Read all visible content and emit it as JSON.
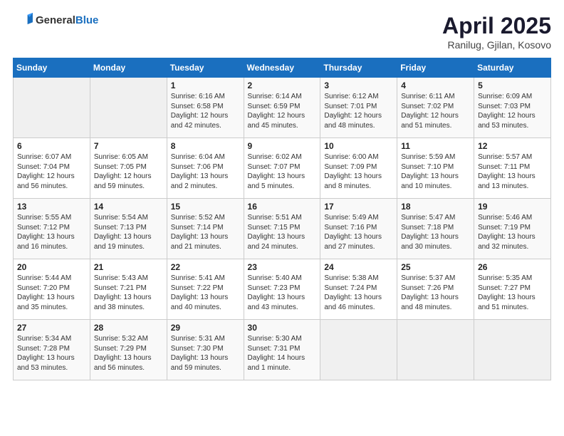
{
  "header": {
    "logo_general": "General",
    "logo_blue": "Blue",
    "title": "April 2025",
    "location": "Ranilug, Gjilan, Kosovo"
  },
  "weekdays": [
    "Sunday",
    "Monday",
    "Tuesday",
    "Wednesday",
    "Thursday",
    "Friday",
    "Saturday"
  ],
  "weeks": [
    [
      {
        "day": "",
        "detail": ""
      },
      {
        "day": "",
        "detail": ""
      },
      {
        "day": "1",
        "detail": "Sunrise: 6:16 AM\nSunset: 6:58 PM\nDaylight: 12 hours and 42 minutes."
      },
      {
        "day": "2",
        "detail": "Sunrise: 6:14 AM\nSunset: 6:59 PM\nDaylight: 12 hours and 45 minutes."
      },
      {
        "day": "3",
        "detail": "Sunrise: 6:12 AM\nSunset: 7:01 PM\nDaylight: 12 hours and 48 minutes."
      },
      {
        "day": "4",
        "detail": "Sunrise: 6:11 AM\nSunset: 7:02 PM\nDaylight: 12 hours and 51 minutes."
      },
      {
        "day": "5",
        "detail": "Sunrise: 6:09 AM\nSunset: 7:03 PM\nDaylight: 12 hours and 53 minutes."
      }
    ],
    [
      {
        "day": "6",
        "detail": "Sunrise: 6:07 AM\nSunset: 7:04 PM\nDaylight: 12 hours and 56 minutes."
      },
      {
        "day": "7",
        "detail": "Sunrise: 6:05 AM\nSunset: 7:05 PM\nDaylight: 12 hours and 59 minutes."
      },
      {
        "day": "8",
        "detail": "Sunrise: 6:04 AM\nSunset: 7:06 PM\nDaylight: 13 hours and 2 minutes."
      },
      {
        "day": "9",
        "detail": "Sunrise: 6:02 AM\nSunset: 7:07 PM\nDaylight: 13 hours and 5 minutes."
      },
      {
        "day": "10",
        "detail": "Sunrise: 6:00 AM\nSunset: 7:09 PM\nDaylight: 13 hours and 8 minutes."
      },
      {
        "day": "11",
        "detail": "Sunrise: 5:59 AM\nSunset: 7:10 PM\nDaylight: 13 hours and 10 minutes."
      },
      {
        "day": "12",
        "detail": "Sunrise: 5:57 AM\nSunset: 7:11 PM\nDaylight: 13 hours and 13 minutes."
      }
    ],
    [
      {
        "day": "13",
        "detail": "Sunrise: 5:55 AM\nSunset: 7:12 PM\nDaylight: 13 hours and 16 minutes."
      },
      {
        "day": "14",
        "detail": "Sunrise: 5:54 AM\nSunset: 7:13 PM\nDaylight: 13 hours and 19 minutes."
      },
      {
        "day": "15",
        "detail": "Sunrise: 5:52 AM\nSunset: 7:14 PM\nDaylight: 13 hours and 21 minutes."
      },
      {
        "day": "16",
        "detail": "Sunrise: 5:51 AM\nSunset: 7:15 PM\nDaylight: 13 hours and 24 minutes."
      },
      {
        "day": "17",
        "detail": "Sunrise: 5:49 AM\nSunset: 7:16 PM\nDaylight: 13 hours and 27 minutes."
      },
      {
        "day": "18",
        "detail": "Sunrise: 5:47 AM\nSunset: 7:18 PM\nDaylight: 13 hours and 30 minutes."
      },
      {
        "day": "19",
        "detail": "Sunrise: 5:46 AM\nSunset: 7:19 PM\nDaylight: 13 hours and 32 minutes."
      }
    ],
    [
      {
        "day": "20",
        "detail": "Sunrise: 5:44 AM\nSunset: 7:20 PM\nDaylight: 13 hours and 35 minutes."
      },
      {
        "day": "21",
        "detail": "Sunrise: 5:43 AM\nSunset: 7:21 PM\nDaylight: 13 hours and 38 minutes."
      },
      {
        "day": "22",
        "detail": "Sunrise: 5:41 AM\nSunset: 7:22 PM\nDaylight: 13 hours and 40 minutes."
      },
      {
        "day": "23",
        "detail": "Sunrise: 5:40 AM\nSunset: 7:23 PM\nDaylight: 13 hours and 43 minutes."
      },
      {
        "day": "24",
        "detail": "Sunrise: 5:38 AM\nSunset: 7:24 PM\nDaylight: 13 hours and 46 minutes."
      },
      {
        "day": "25",
        "detail": "Sunrise: 5:37 AM\nSunset: 7:26 PM\nDaylight: 13 hours and 48 minutes."
      },
      {
        "day": "26",
        "detail": "Sunrise: 5:35 AM\nSunset: 7:27 PM\nDaylight: 13 hours and 51 minutes."
      }
    ],
    [
      {
        "day": "27",
        "detail": "Sunrise: 5:34 AM\nSunset: 7:28 PM\nDaylight: 13 hours and 53 minutes."
      },
      {
        "day": "28",
        "detail": "Sunrise: 5:32 AM\nSunset: 7:29 PM\nDaylight: 13 hours and 56 minutes."
      },
      {
        "day": "29",
        "detail": "Sunrise: 5:31 AM\nSunset: 7:30 PM\nDaylight: 13 hours and 59 minutes."
      },
      {
        "day": "30",
        "detail": "Sunrise: 5:30 AM\nSunset: 7:31 PM\nDaylight: 14 hours and 1 minute."
      },
      {
        "day": "",
        "detail": ""
      },
      {
        "day": "",
        "detail": ""
      },
      {
        "day": "",
        "detail": ""
      }
    ]
  ]
}
